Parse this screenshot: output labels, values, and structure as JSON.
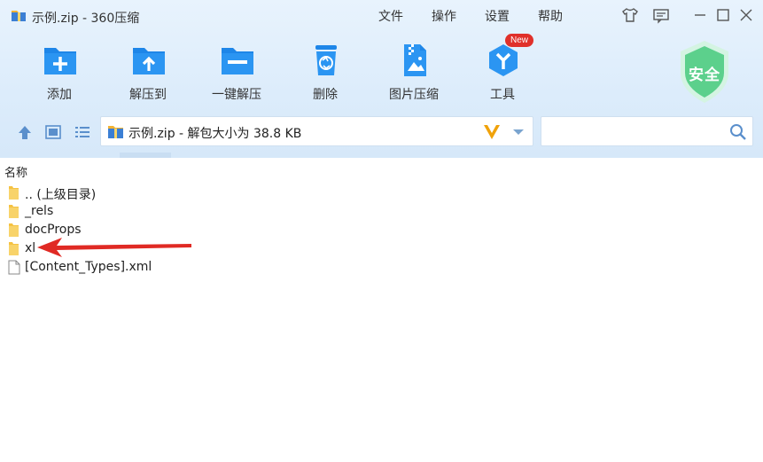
{
  "window": {
    "title": "示例.zip - 360压缩",
    "menu": [
      "文件",
      "操作",
      "设置",
      "帮助"
    ]
  },
  "toolbar": {
    "items": [
      {
        "label": "添加",
        "icon": "add-icon"
      },
      {
        "label": "解压到",
        "icon": "extract-to-icon"
      },
      {
        "label": "一键解压",
        "icon": "one-click-extract-icon"
      },
      {
        "label": "删除",
        "icon": "delete-icon"
      },
      {
        "label": "图片压缩",
        "icon": "image-compress-icon"
      },
      {
        "label": "工具",
        "icon": "tools-icon"
      }
    ],
    "new_badge": "New",
    "security_label": "安全"
  },
  "address": {
    "path": "示例.zip - 解包大小为 38.8 KB"
  },
  "search": {
    "placeholder": ""
  },
  "list": {
    "column_name": "名称",
    "items": [
      {
        "name": ".. (上级目录)",
        "type": "folder"
      },
      {
        "name": "_rels",
        "type": "folder"
      },
      {
        "name": "docProps",
        "type": "folder"
      },
      {
        "name": "xl",
        "type": "folder"
      },
      {
        "name": "[Content_Types].xml",
        "type": "file"
      }
    ]
  },
  "colors": {
    "toolbar_bg": "#dcecfb",
    "icon_blue": "#1e86e8",
    "arrow_red": "#e02a24",
    "shield_green": "#5cd08c",
    "folder_yellow": "#f5c242"
  }
}
